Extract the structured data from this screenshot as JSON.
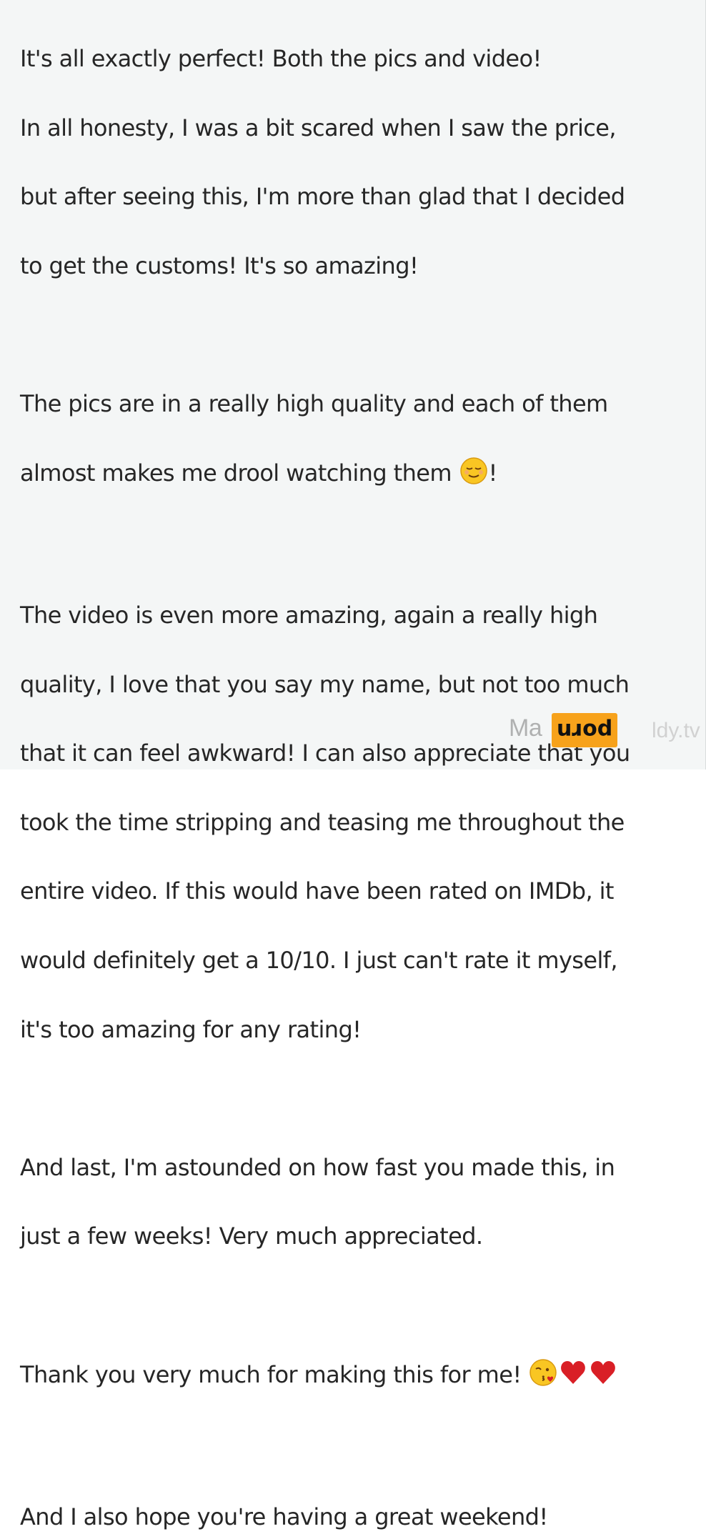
{
  "message": {
    "paragraphs": [
      [
        "It's all exactly perfect! Both the pics and video!",
        "In all honesty, I was a bit scared when I saw the price,",
        "but after seeing this, I'm more than glad that I decided",
        "to get the customs! It's so amazing!"
      ],
      [
        "The pics are in a really high quality and each of them",
        "almost makes me drool watching them"
      ],
      [
        "The video is even more amazing, again a really high",
        "quality, I love that you say my name, but not too much",
        "that it can feel awkward! I can also appreciate that you",
        "took the time stripping and teasing me throughout the",
        "entire video. If this would have been rated on IMDb, it",
        "would definitely get a 10/10. I just can't rate it myself,",
        "it's too amazing for any rating!"
      ],
      [
        "And last, I'm astounded on how fast you made this, in",
        "just a few weeks! Very much appreciated."
      ],
      [
        "Thank you very much for making this for me!"
      ],
      [
        "And I also hope you're having a great weekend!"
      ]
    ],
    "after_drool_emoji": "!",
    "emojis": {
      "drool_line": "relieved-face",
      "thanks_line": [
        "kissing-heart-face",
        "red-heart",
        "red-heart"
      ]
    }
  },
  "watermark": {
    "prefix": "Ma",
    "badge": "porn",
    "tld": "ldy.tv"
  },
  "colors": {
    "background": "#f4f6f6",
    "text": "#262626",
    "badge": "#f7a21b",
    "heart": "#d91f26"
  }
}
